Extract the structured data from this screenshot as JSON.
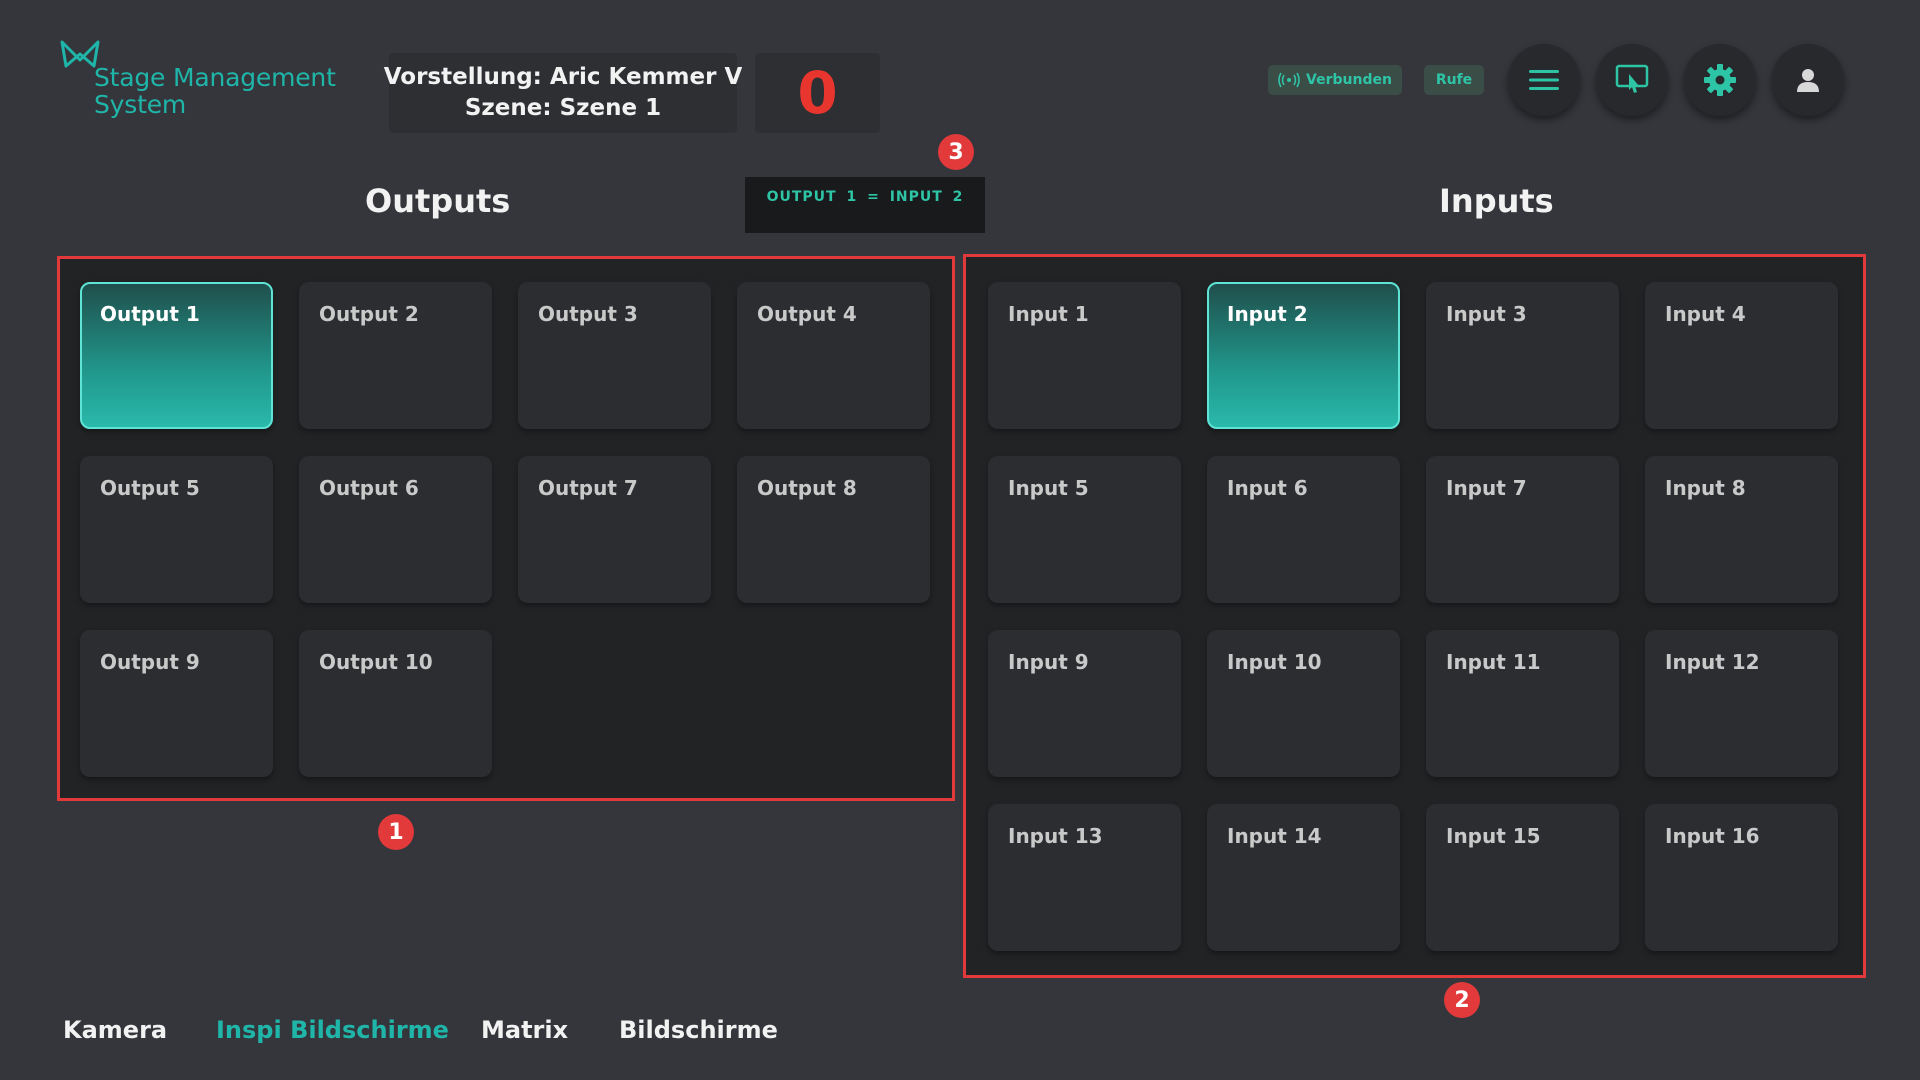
{
  "brand": {
    "name_line1": "Stage Management",
    "name_line2": "System",
    "color": "#1fb5a9"
  },
  "show": {
    "line1": "Vorstellung: Aric Kemmer V",
    "line2": "Szene: Szene 1"
  },
  "counter": "0",
  "status": {
    "connected_label": "Verbunden",
    "call_label": "Rufe"
  },
  "toolbar_icons": [
    "menu-icon",
    "screen-touch-icon",
    "gear-icon",
    "user-icon"
  ],
  "outputs": {
    "title": "Outputs",
    "tiles": [
      "Output 1",
      "Output 2",
      "Output 3",
      "Output 4",
      "Output 5",
      "Output 6",
      "Output 7",
      "Output 8",
      "Output 9",
      "Output 10"
    ],
    "active_index": 0
  },
  "inputs": {
    "title": "Inputs",
    "tiles": [
      "Input 1",
      "Input 2",
      "Input 3",
      "Input 4",
      "Input 5",
      "Input 6",
      "Input 7",
      "Input 8",
      "Input 9",
      "Input 10",
      "Input 11",
      "Input 12",
      "Input 13",
      "Input 14",
      "Input 15",
      "Input 16"
    ],
    "active_index": 1
  },
  "routing": {
    "output": "OUTPUT 1",
    "operator": "=",
    "input": "INPUT 2"
  },
  "markers": {
    "outputs_panel": "1",
    "inputs_panel": "2",
    "routing_box": "3"
  },
  "nav": {
    "items": [
      "Kamera",
      "Inspi Bildschirme",
      "Matrix",
      "Bildschirme"
    ],
    "active_index": 1
  },
  "colors": {
    "accent": "#1fb5a9",
    "counter": "#e8362f",
    "highlight": "#e23a3a"
  }
}
